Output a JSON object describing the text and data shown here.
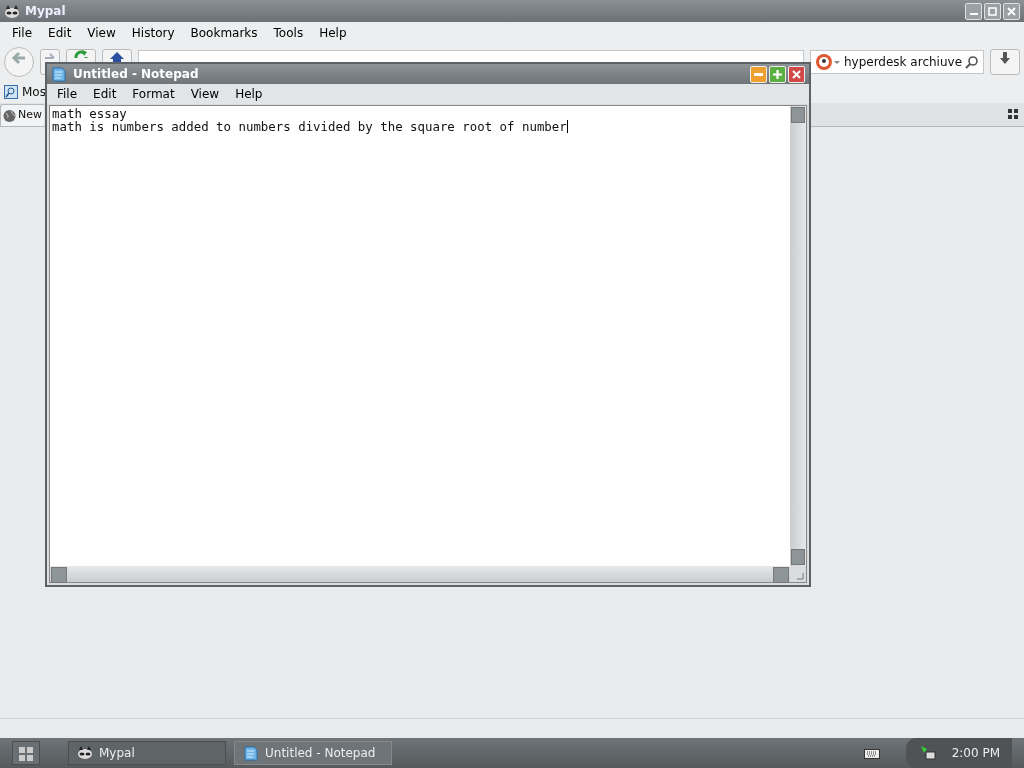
{
  "browser": {
    "title": "Mypal",
    "menu": [
      "File",
      "Edit",
      "View",
      "History",
      "Bookmarks",
      "Tools",
      "Help"
    ],
    "search": {
      "value": "hyperdesk archiuve"
    },
    "bookmarks": [
      {
        "label": "Mos"
      }
    ],
    "tabs": [
      {
        "label": "New",
        "selected": true
      }
    ]
  },
  "notepad": {
    "title": "Untitled - Notepad",
    "menu": [
      "File",
      "Edit",
      "Format",
      "View",
      "Help"
    ],
    "lines": [
      "math essay",
      "math is numbers added to numbers divided by the square root of number"
    ]
  },
  "taskbar": {
    "tasks": [
      {
        "label": "Mypal",
        "kind": "browser",
        "selected": false
      },
      {
        "label": "Untitled - Notepad",
        "kind": "notepad",
        "selected": true
      }
    ],
    "clock": "2:00 PM"
  }
}
